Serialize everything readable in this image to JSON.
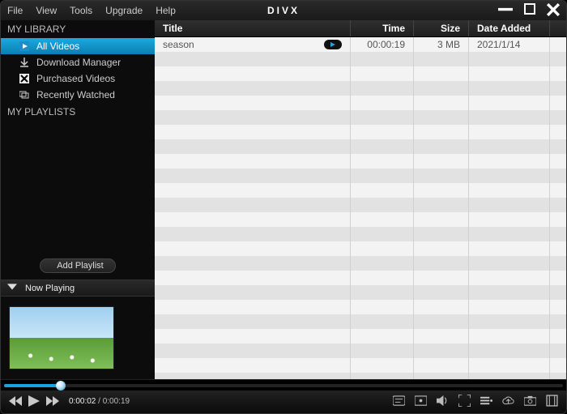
{
  "menu": {
    "file": "File",
    "view": "View",
    "tools": "Tools",
    "upgrade": "Upgrade",
    "help": "Help"
  },
  "app_name": "DIVX",
  "sidebar": {
    "library_header": "MY LIBRARY",
    "items": [
      {
        "label": "All Videos",
        "icon": "play-icon",
        "active": true
      },
      {
        "label": "Download Manager",
        "icon": "download-icon",
        "active": false
      },
      {
        "label": "Purchased Videos",
        "icon": "purchased-icon",
        "active": false
      },
      {
        "label": "Recently Watched",
        "icon": "recent-icon",
        "active": false
      }
    ],
    "playlists_header": "MY PLAYLISTS",
    "add_playlist": "Add Playlist",
    "now_playing": "Now Playing"
  },
  "columns": {
    "title": "Title",
    "time": "Time",
    "size": "Size",
    "date": "Date Added"
  },
  "rows": [
    {
      "title": "season",
      "time": "00:00:19",
      "size": "3 MB",
      "date": "2021/1/14",
      "playing": true
    }
  ],
  "playback": {
    "current": "0:00:02",
    "total": "0:00:19",
    "sep": " / "
  }
}
